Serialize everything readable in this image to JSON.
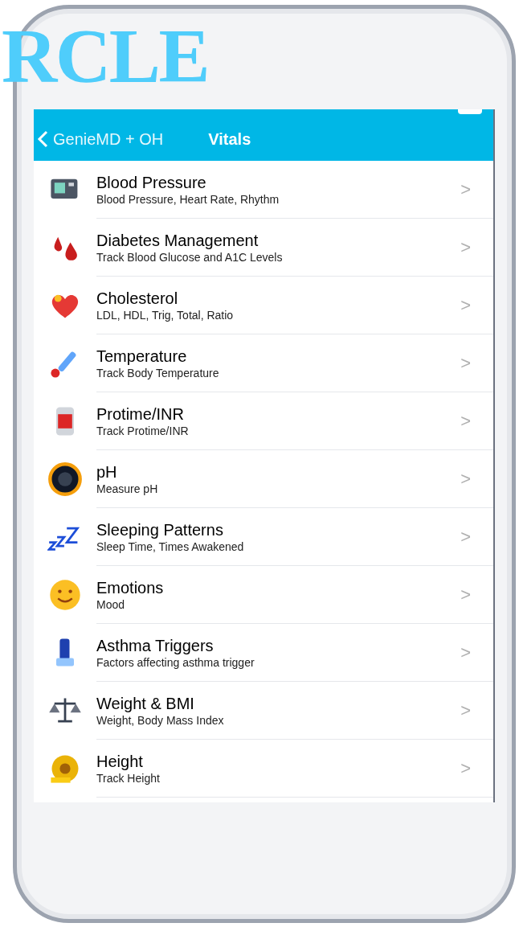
{
  "overlay_title": "RCLE",
  "nav": {
    "back_label": "GenieMD + OH",
    "title": "Vitals"
  },
  "items": [
    {
      "title": "Blood Pressure",
      "subtitle": "Blood Pressure, Heart Rate, Rhythm",
      "chevron": ">"
    },
    {
      "title": "Diabetes Management",
      "subtitle": "Track Blood Glucose and A1C Levels",
      "chevron": ">"
    },
    {
      "title": "Cholesterol",
      "subtitle": "LDL, HDL, Trig, Total, Ratio",
      "chevron": ">"
    },
    {
      "title": "Temperature",
      "subtitle": "Track Body Temperature",
      "chevron": ">"
    },
    {
      "title": "Protime/INR",
      "subtitle": "Track Protime/INR",
      "chevron": ">"
    },
    {
      "title": "pH",
      "subtitle": "Measure pH",
      "chevron": ">"
    },
    {
      "title": "Sleeping Patterns",
      "subtitle": "Sleep Time, Times Awakened",
      "chevron": ">"
    },
    {
      "title": "Emotions",
      "subtitle": "Mood",
      "chevron": ">"
    },
    {
      "title": "Asthma Triggers",
      "subtitle": "Factors affecting asthma trigger",
      "chevron": ">"
    },
    {
      "title": "Weight & BMI",
      "subtitle": "Weight, Body Mass Index",
      "chevron": ">"
    },
    {
      "title": "Height",
      "subtitle": "Track Height",
      "chevron": ">"
    }
  ]
}
